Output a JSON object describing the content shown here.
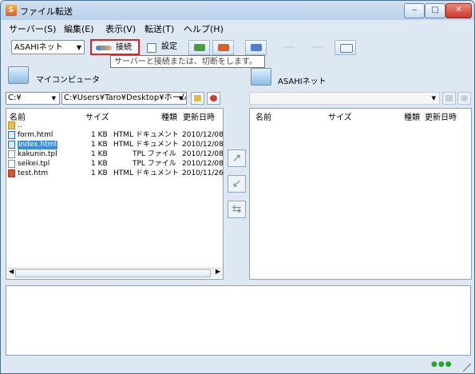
{
  "window": {
    "title": "ファイル転送",
    "app_icon": "ftp-app-icon",
    "controls": {
      "minimize": "‒",
      "maximize": "□",
      "close": "✕"
    }
  },
  "menu": [
    "サーバー(S)",
    "編集(E)",
    "表示(V)",
    "転送(T)",
    "ヘルプ(H)"
  ],
  "toolbar": {
    "server": "ASAHIネット",
    "connect": "接続",
    "settings": "設定"
  },
  "tooltip": "サーバーと接続または、切断をします。",
  "local": {
    "label": "マイコンピュータ",
    "drive": "C:¥",
    "path": "C:¥Users¥Taro¥Desktop¥ホーム",
    "headers": {
      "name": "名前",
      "size": "サイズ",
      "type": "種類",
      "date": "更新日時"
    },
    "files": [
      {
        "name": "..",
        "size": "",
        "type": "",
        "date": "",
        "icon": "folder-up-icon"
      },
      {
        "name": "form.html",
        "size": "1 KB",
        "type": "HTML ドキュメント",
        "date": "2010/12/08",
        "icon": "html-file-icon"
      },
      {
        "name": "index.html",
        "size": "1 KB",
        "type": "HTML ドキュメント",
        "date": "2010/12/08",
        "icon": "html-file-icon",
        "selected": true
      },
      {
        "name": "kakunin.tpl",
        "size": "1 KB",
        "type": "TPL ファイル",
        "date": "2010/12/08",
        "icon": "file-icon"
      },
      {
        "name": "seikei.tpl",
        "size": "1 KB",
        "type": "TPL ファイル",
        "date": "2010/12/08",
        "icon": "file-icon"
      },
      {
        "name": "test.htm",
        "size": "1 KB",
        "type": "HTML ドキュメント",
        "date": "2010/11/26",
        "icon": "htm-file-icon"
      }
    ]
  },
  "remote": {
    "label": "ASAHIネット",
    "path": "",
    "headers": {
      "name": "名前",
      "size": "サイズ",
      "type": "種類",
      "date": "更新日時"
    }
  },
  "status": {
    "indicator": "●●●"
  },
  "colors": {
    "selected": "#3b8de4",
    "connect_outline": "#e5221e"
  }
}
